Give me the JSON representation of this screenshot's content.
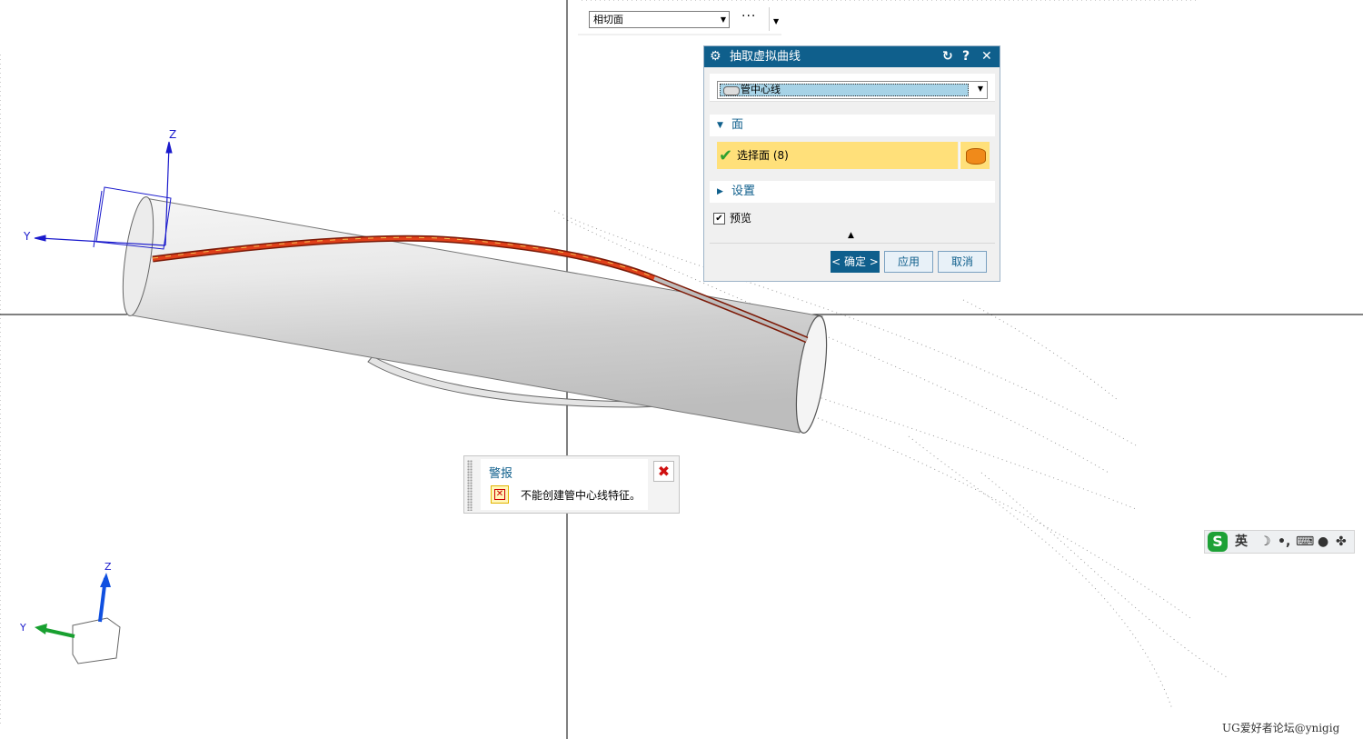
{
  "toolbar": {
    "filter_value": "相切面",
    "more_label": "···"
  },
  "dialog": {
    "title": "抽取虚拟曲线",
    "reset_icon": "reset-icon",
    "help_label": "?",
    "close_label": "✕",
    "type_value": "管中心线",
    "face_group": "面",
    "select_face_label": "选择面 (8)",
    "settings_group": "设置",
    "preview_label": "预览",
    "preview_checked": true,
    "ok_label": "< 确定 >",
    "apply_label": "应用",
    "cancel_label": "取消"
  },
  "alert": {
    "title": "警报",
    "message": "不能创建管中心线特征。",
    "close_label": "✖"
  },
  "viewport": {
    "csys_top": {
      "z_label": "Z",
      "y_label": "Y"
    },
    "csys_bottom": {
      "z_label": "Z",
      "y_label": "Y"
    }
  },
  "ime": {
    "logo": "S",
    "mode_label": "英",
    "icons": [
      "moon-icon",
      "punctuation-icon",
      "keyboard-icon",
      "user-icon",
      "grid-icon"
    ]
  },
  "watermark": "UG爱好者论坛@ynigig",
  "colors": {
    "title_bar": "#0f5f8c",
    "selection_highlight": "#ffe07a",
    "curve_highlight": "#d42a10"
  }
}
